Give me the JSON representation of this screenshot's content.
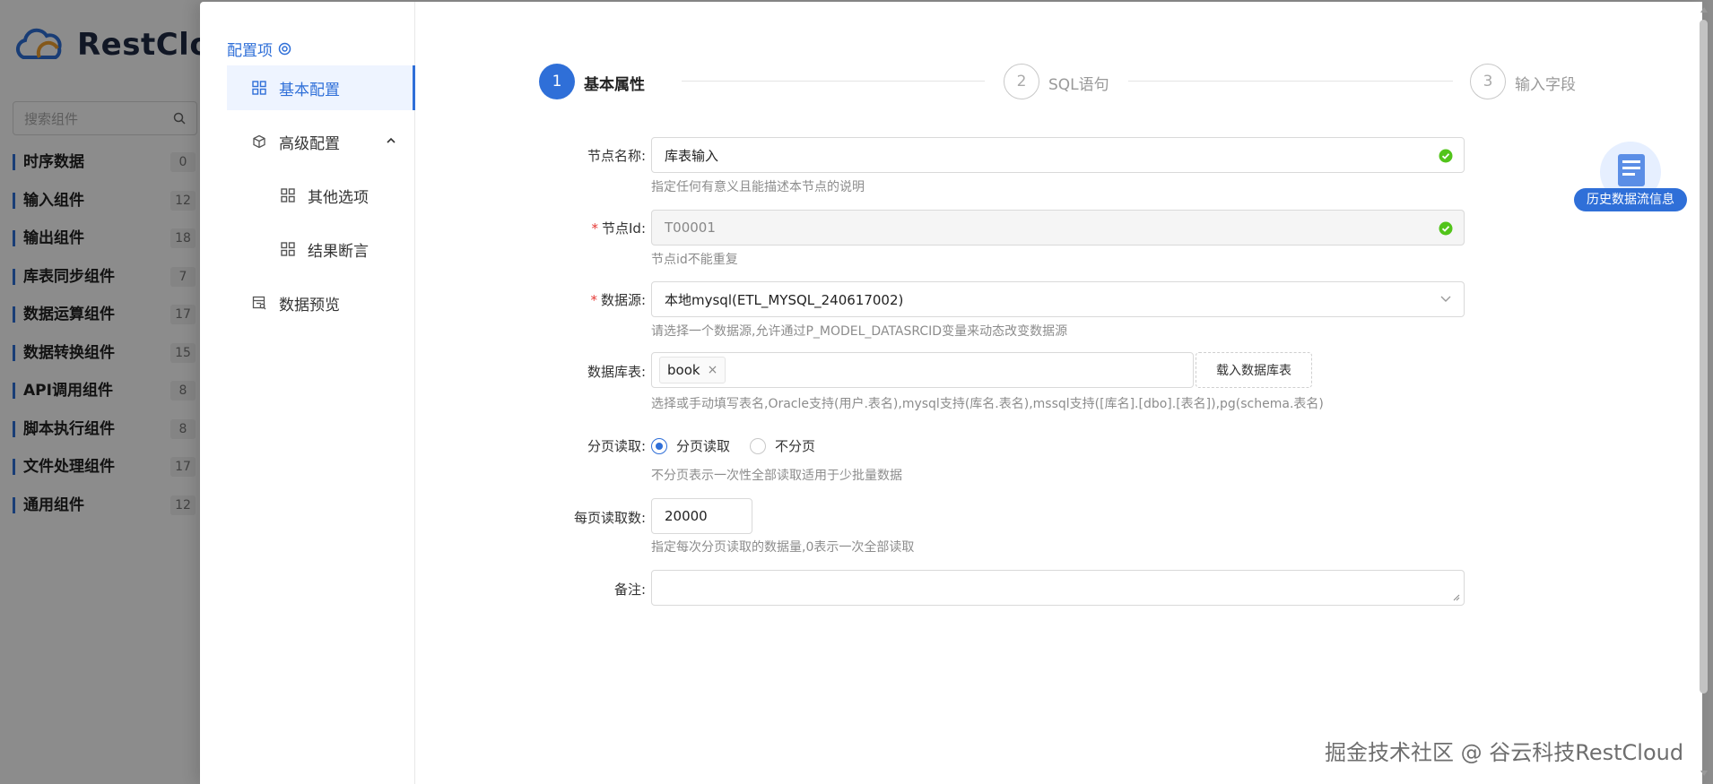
{
  "background_app": {
    "brand": "RestClou",
    "search_placeholder": "搜索组件",
    "categories": [
      {
        "label": "时序数据",
        "count": "0"
      },
      {
        "label": "输入组件",
        "count": "12"
      },
      {
        "label": "输出组件",
        "count": "18"
      },
      {
        "label": "库表同步组件",
        "count": "7"
      },
      {
        "label": "数据运算组件",
        "count": "17"
      },
      {
        "label": "数据转换组件",
        "count": "15"
      },
      {
        "label": "API调用组件",
        "count": "8"
      },
      {
        "label": "脚本执行组件",
        "count": "8"
      },
      {
        "label": "文件处理组件",
        "count": "17"
      },
      {
        "label": "通用组件",
        "count": "12"
      }
    ]
  },
  "config_nav": {
    "title": "配置项",
    "items": [
      {
        "label": "基本配置",
        "active": true
      },
      {
        "label": "高级配置"
      },
      {
        "label": "其他选项"
      },
      {
        "label": "结果断言"
      },
      {
        "label": "数据预览"
      }
    ]
  },
  "stepper": {
    "steps": [
      {
        "num": "1",
        "label": "基本属性"
      },
      {
        "num": "2",
        "label": "SQL语句"
      },
      {
        "num": "3",
        "label": "输入字段"
      }
    ]
  },
  "form": {
    "node_name": {
      "label": "节点名称:",
      "value": "库表输入",
      "hint": "指定任何有意义且能描述本节点的说明"
    },
    "node_id": {
      "required": "*",
      "label": "节点Id:",
      "value": "T00001",
      "hint": "节点id不能重复"
    },
    "datasource": {
      "required": "*",
      "label": "数据源:",
      "value": "本地mysql(ETL_MYSQL_240617002)",
      "hint": "请选择一个数据源,允许通过P_MODEL_DATASRCID变量来动态改变数据源"
    },
    "tables": {
      "label": "数据库表:",
      "tag": "book",
      "tag_close": "×",
      "load_button": "载入数据库表",
      "hint": "选择或手动填写表名,Oracle支持(用户.表名),mysql支持(库名.表名),mssql支持([库名].[dbo].[表名]),pg(schema.表名)"
    },
    "paging": {
      "label": "分页读取:",
      "option_paged": "分页读取",
      "option_nopage": "不分页",
      "hint": "不分页表示一次性全部读取适用于少批量数据"
    },
    "page_size": {
      "label": "每页读取数:",
      "value": "20000",
      "hint": "指定每次分页读取的数据量,0表示一次全部读取"
    },
    "remark": {
      "label": "备注:",
      "value": ""
    }
  },
  "history": {
    "label": "历史数据流信息"
  },
  "watermark": "掘金技术社区 @ 谷云科技RestCloud",
  "colors": {
    "accent": "#2f6fd8",
    "ok": "#52c41a",
    "required": "#e53935"
  }
}
